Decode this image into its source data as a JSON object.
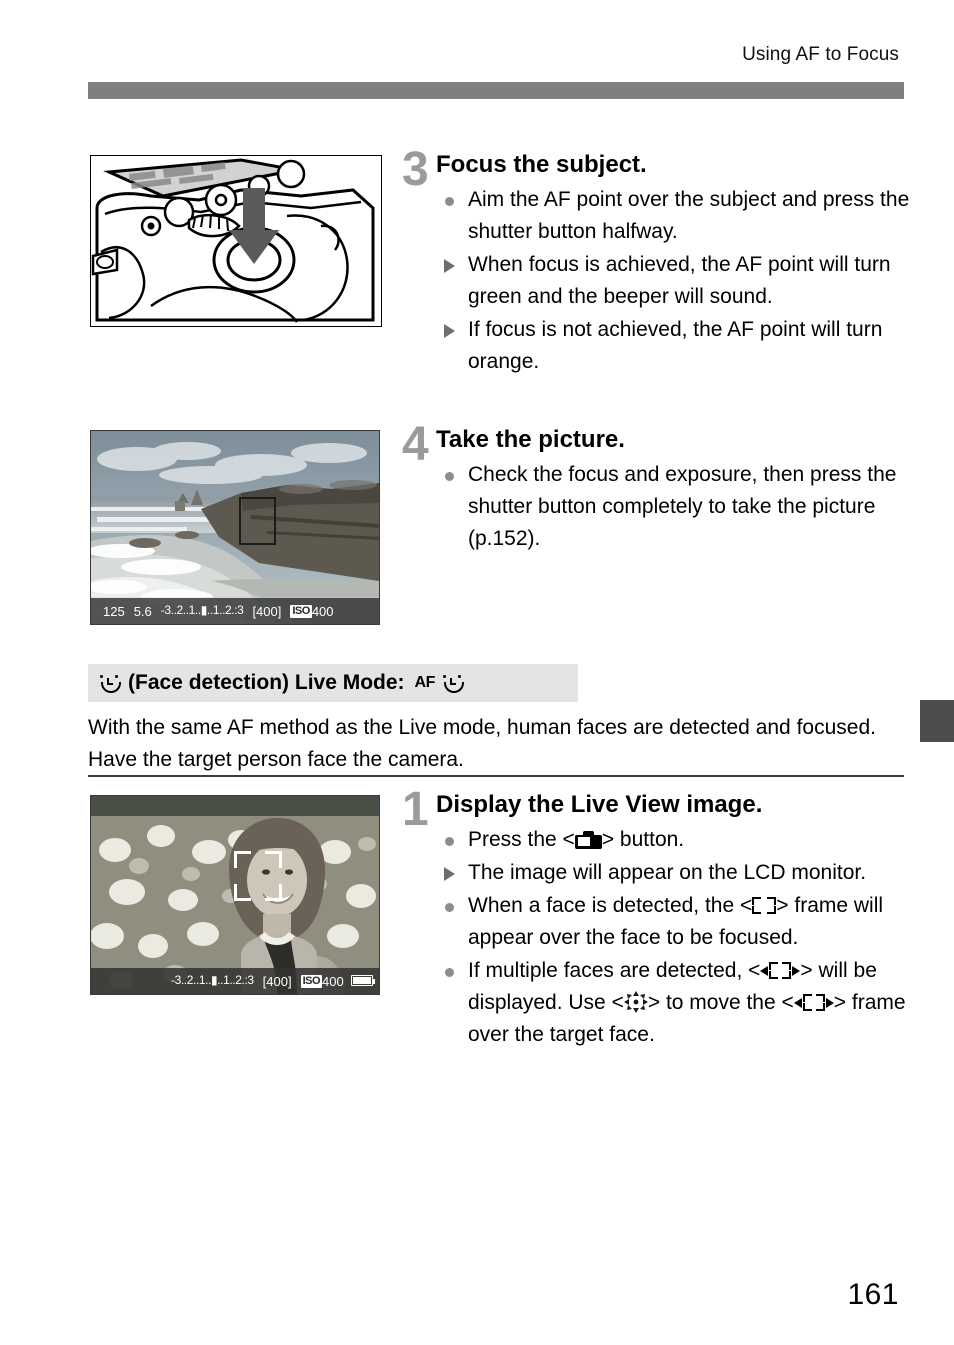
{
  "header": {
    "running_head": "Using AF to Focus"
  },
  "page_number": "161",
  "illustrations": {
    "camera_top": {
      "name": "camera-top-line-art",
      "description": "Line drawing of camera top plate with shutter button and downward press arrow"
    },
    "lcd_landscape": {
      "name": "live-view-landscape-screenshot",
      "description": "Live View of coastal cliffs and beach with AF point rectangle",
      "infobar": {
        "shutter_speed": "125",
        "aperture": "5.6",
        "exposure_scale": "-3..2..1..▮..1..2.:3",
        "shots_remaining": "[400]",
        "iso_label": "ISO",
        "iso_value": "400"
      }
    },
    "lcd_portrait": {
      "name": "live-view-face-detection-screenshot",
      "description": "Live View of a smiling woman among flowers with white face detection frame",
      "infobar": {
        "exposure_scale": "-3..2..1..▮..1..2.:3",
        "shots_remaining": "[400]",
        "iso_label": "ISO",
        "iso_value": "400",
        "battery": "battery-full-icon"
      }
    }
  },
  "steps": [
    {
      "number": "3",
      "title": "Focus the subject.",
      "bullets": [
        {
          "marker": "dot",
          "text": "Aim the AF point over the subject and press the shutter button halfway."
        },
        {
          "marker": "triangle",
          "text": "When focus is achieved, the AF point will turn green and the beeper will sound."
        },
        {
          "marker": "triangle",
          "text": "If focus is not achieved, the AF point will turn orange."
        }
      ]
    },
    {
      "number": "4",
      "title": "Take the picture.",
      "bullets": [
        {
          "marker": "dot",
          "text": "Check the focus and exposure, then press the shutter button completely to take the picture (p.152)."
        }
      ]
    }
  ],
  "section": {
    "heading_icon": "face-smiley-icon",
    "heading_text": "(Face detection) Live Mode:",
    "heading_mode_label": "AF",
    "heading_mode_icon": "face-smiley-icon",
    "body": "With the same AF method as the Live mode, human faces are detected and focused. Have the target person face the camera.",
    "step": {
      "number": "1",
      "title": "Display the Live View image.",
      "bullets": [
        {
          "marker": "dot",
          "parts": [
            {
              "type": "text",
              "value": "Press the <"
            },
            {
              "type": "icon",
              "value": "camera-icon"
            },
            {
              "type": "text",
              "value": "> button."
            }
          ]
        },
        {
          "marker": "triangle",
          "parts": [
            {
              "type": "text",
              "value": "The image will appear on the LCD monitor."
            }
          ]
        },
        {
          "marker": "dot",
          "parts": [
            {
              "type": "text",
              "value": "When a face is detected, the <"
            },
            {
              "type": "icon",
              "value": "face-frame-icon"
            },
            {
              "type": "text",
              "value": "> frame will appear over the face to be focused."
            }
          ]
        },
        {
          "marker": "dot",
          "parts": [
            {
              "type": "text",
              "value": "If multiple faces are detected, <"
            },
            {
              "type": "icon",
              "value": "face-frame-arrows-icon"
            },
            {
              "type": "text",
              "value": "> will be displayed. Use <"
            },
            {
              "type": "icon",
              "value": "multi-controller-icon"
            },
            {
              "type": "text",
              "value": "> to move the <"
            },
            {
              "type": "icon",
              "value": "face-frame-arrows-icon"
            },
            {
              "type": "text",
              "value": "> frame over the target face."
            }
          ]
        }
      ]
    }
  },
  "colors": {
    "rule": "#7f7f7f",
    "heading_background": "#e4e4e4",
    "step_number": "#9a9a9a",
    "tab": "#4d4d4d"
  }
}
